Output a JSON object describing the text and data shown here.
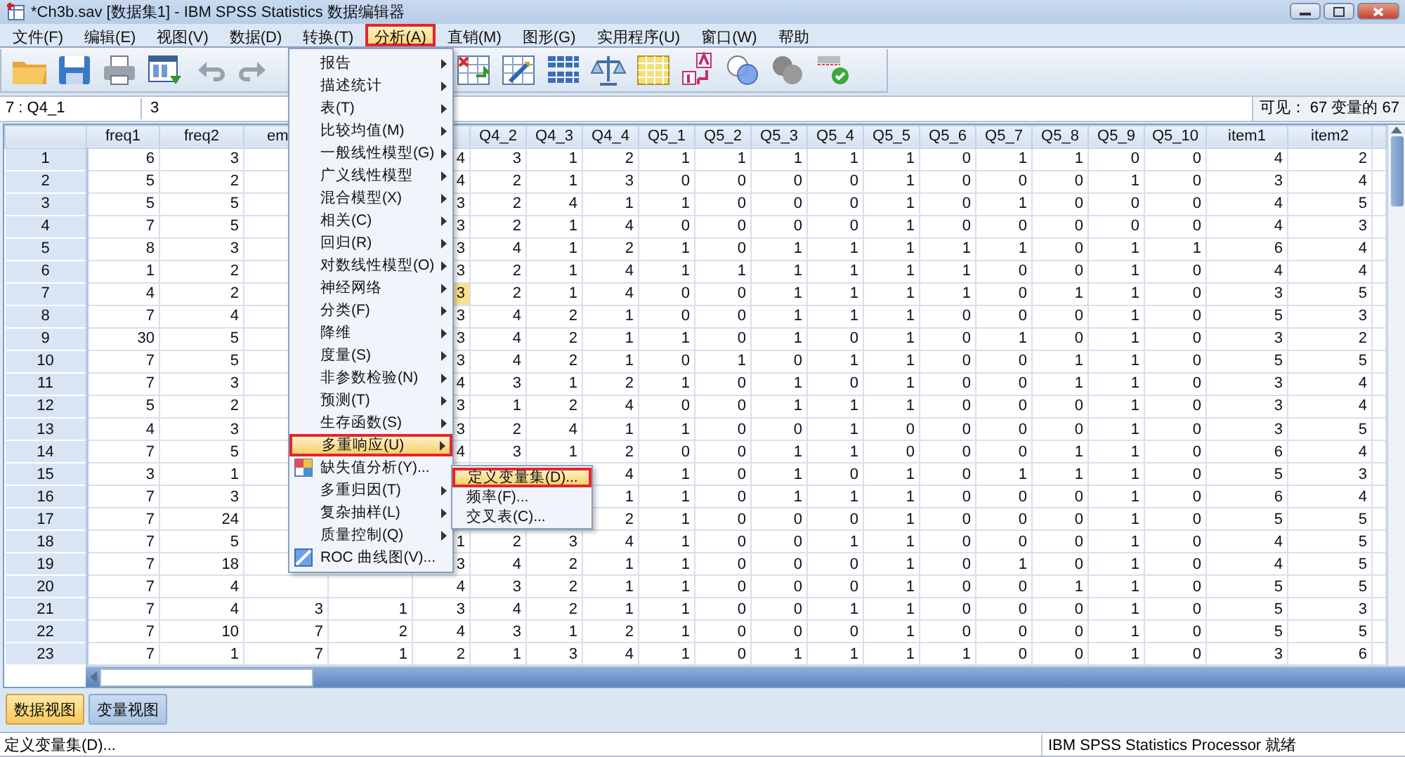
{
  "window": {
    "title": "*Ch3b.sav [数据集1] - IBM SPSS Statistics 数据编辑器"
  },
  "menu_bar": [
    {
      "label": "文件(F)",
      "selected": false,
      "marked": false
    },
    {
      "label": "编辑(E)",
      "selected": false,
      "marked": false
    },
    {
      "label": "视图(V)",
      "selected": false,
      "marked": false
    },
    {
      "label": "数据(D)",
      "selected": false,
      "marked": false
    },
    {
      "label": "转换(T)",
      "selected": false,
      "marked": false
    },
    {
      "label": "分析(A)",
      "selected": true,
      "marked": true
    },
    {
      "label": "直销(M)",
      "selected": false,
      "marked": false
    },
    {
      "label": "图形(G)",
      "selected": false,
      "marked": false
    },
    {
      "label": "实用程序(U)",
      "selected": false,
      "marked": false
    },
    {
      "label": "窗口(W)",
      "selected": false,
      "marked": false
    },
    {
      "label": "帮助",
      "selected": false,
      "marked": false
    }
  ],
  "cell_editor": {
    "cell": "7 : Q4_1",
    "value": "3",
    "visible_count": "可见： 67 变量的 67"
  },
  "table": {
    "columns": [
      "freq1",
      "freq2",
      "em",
      null,
      null,
      "Q4_2",
      "Q4_3",
      "Q4_4",
      "Q5_1",
      "Q5_2",
      "Q5_3",
      "Q5_4",
      "Q5_5",
      "Q5_6",
      "Q5_7",
      "Q5_8",
      "Q5_9",
      "Q5_10",
      "item1",
      "item2"
    ],
    "rows": [
      {
        "label": "1",
        "cells": [
          "6",
          "3",
          null,
          null,
          "4",
          "3",
          "1",
          "2",
          "1",
          "1",
          "1",
          "1",
          "1",
          "0",
          "1",
          "1",
          "0",
          "0",
          "4",
          "2"
        ]
      },
      {
        "label": "2",
        "cells": [
          "5",
          "2",
          null,
          null,
          "4",
          "2",
          "1",
          "3",
          "0",
          "0",
          "0",
          "0",
          "1",
          "0",
          "0",
          "0",
          "1",
          "0",
          "3",
          "4"
        ]
      },
      {
        "label": "3",
        "cells": [
          "5",
          "5",
          null,
          null,
          "3",
          "2",
          "4",
          "1",
          "1",
          "0",
          "0",
          "0",
          "1",
          "0",
          "1",
          "0",
          "0",
          "0",
          "4",
          "5"
        ]
      },
      {
        "label": "4",
        "cells": [
          "7",
          "5",
          null,
          null,
          "3",
          "2",
          "1",
          "4",
          "0",
          "0",
          "0",
          "0",
          "1",
          "0",
          "0",
          "0",
          "0",
          "0",
          "4",
          "3"
        ]
      },
      {
        "label": "5",
        "cells": [
          "8",
          "3",
          null,
          null,
          "3",
          "4",
          "1",
          "2",
          "1",
          "0",
          "1",
          "1",
          "1",
          "1",
          "1",
          "0",
          "1",
          "1",
          "6",
          "4"
        ]
      },
      {
        "label": "6",
        "cells": [
          "1",
          "2",
          null,
          null,
          "3",
          "2",
          "1",
          "4",
          "1",
          "1",
          "1",
          "1",
          "1",
          "1",
          "0",
          "0",
          "1",
          "0",
          "4",
          "4"
        ]
      },
      {
        "label": "7",
        "cells": [
          "4",
          "2",
          null,
          null,
          {
            "value": "3",
            "selected": true
          },
          "2",
          "1",
          "4",
          "0",
          "0",
          "1",
          "1",
          "1",
          "1",
          "0",
          "1",
          "1",
          "0",
          "3",
          "5"
        ]
      },
      {
        "label": "8",
        "cells": [
          "7",
          "4",
          null,
          null,
          "3",
          "4",
          "2",
          "1",
          "0",
          "0",
          "1",
          "1",
          "1",
          "0",
          "0",
          "0",
          "1",
          "0",
          "5",
          "3"
        ]
      },
      {
        "label": "9",
        "cells": [
          "30",
          "5",
          null,
          null,
          "3",
          "4",
          "2",
          "1",
          "1",
          "0",
          "1",
          "0",
          "1",
          "0",
          "1",
          "0",
          "1",
          "0",
          "3",
          "2"
        ]
      },
      {
        "label": "10",
        "cells": [
          "7",
          "5",
          null,
          null,
          "3",
          "4",
          "2",
          "1",
          "0",
          "1",
          "0",
          "1",
          "1",
          "0",
          "0",
          "1",
          "1",
          "0",
          "5",
          "5"
        ]
      },
      {
        "label": "11",
        "cells": [
          "7",
          "3",
          null,
          null,
          "4",
          "3",
          "1",
          "2",
          "1",
          "0",
          "1",
          "0",
          "1",
          "0",
          "0",
          "1",
          "1",
          "0",
          "3",
          "4"
        ]
      },
      {
        "label": "12",
        "cells": [
          "5",
          "2",
          null,
          null,
          "3",
          "1",
          "2",
          "4",
          "0",
          "0",
          "1",
          "1",
          "1",
          "0",
          "0",
          "0",
          "1",
          "0",
          "3",
          "4"
        ]
      },
      {
        "label": "13",
        "cells": [
          "4",
          "3",
          null,
          null,
          "3",
          "2",
          "4",
          "1",
          "1",
          "0",
          "0",
          "1",
          "0",
          "0",
          "0",
          "0",
          "1",
          "0",
          "3",
          "5"
        ]
      },
      {
        "label": "14",
        "cells": [
          "7",
          "5",
          null,
          null,
          "4",
          "3",
          "1",
          "2",
          "0",
          "0",
          "1",
          "1",
          "0",
          "0",
          "0",
          "1",
          "1",
          "0",
          "6",
          "4"
        ]
      },
      {
        "label": "15",
        "cells": [
          "3",
          "1",
          null,
          null,
          null,
          null,
          null,
          "4",
          "1",
          "0",
          "1",
          "0",
          "1",
          "0",
          "1",
          "1",
          "1",
          "0",
          "5",
          "3"
        ]
      },
      {
        "label": "16",
        "cells": [
          "7",
          "3",
          null,
          null,
          null,
          null,
          null,
          "1",
          "1",
          "0",
          "1",
          "1",
          "1",
          "0",
          "0",
          "0",
          "1",
          "0",
          "6",
          "4"
        ]
      },
      {
        "label": "17",
        "cells": [
          "7",
          "24",
          null,
          null,
          null,
          null,
          null,
          "2",
          "1",
          "0",
          "0",
          "0",
          "1",
          "0",
          "0",
          "0",
          "1",
          "0",
          "5",
          "5"
        ]
      },
      {
        "label": "18",
        "cells": [
          "7",
          "5",
          null,
          null,
          "1",
          "2",
          "3",
          "4",
          "1",
          "0",
          "0",
          "1",
          "1",
          "0",
          "0",
          "0",
          "1",
          "0",
          "4",
          "5"
        ]
      },
      {
        "label": "19",
        "cells": [
          "7",
          "18",
          null,
          null,
          "3",
          "4",
          "2",
          "1",
          "1",
          "0",
          "0",
          "0",
          "1",
          "0",
          "1",
          "0",
          "1",
          "0",
          "4",
          "5"
        ]
      },
      {
        "label": "20",
        "cells": [
          "7",
          "4",
          null,
          null,
          "4",
          "3",
          "2",
          "1",
          "1",
          "0",
          "0",
          "0",
          "1",
          "0",
          "0",
          "1",
          "1",
          "0",
          "5",
          "5"
        ]
      },
      {
        "label": "21",
        "cells": [
          "7",
          "4",
          "3",
          "1",
          "3",
          "4",
          "2",
          "1",
          "1",
          "0",
          "0",
          "1",
          "1",
          "0",
          "0",
          "0",
          "1",
          "0",
          "5",
          "3"
        ]
      },
      {
        "label": "22",
        "cells": [
          "7",
          "10",
          "7",
          "2",
          "4",
          "3",
          "1",
          "2",
          "1",
          "0",
          "0",
          "0",
          "1",
          "0",
          "0",
          "0",
          "1",
          "0",
          "5",
          "5"
        ]
      },
      {
        "label": "23",
        "cells": [
          "7",
          "1",
          "7",
          "1",
          "2",
          "1",
          "3",
          "4",
          "1",
          "0",
          "1",
          "1",
          "1",
          "1",
          "0",
          "0",
          "1",
          "0",
          "3",
          "6"
        ]
      }
    ]
  },
  "view_tabs": [
    {
      "label": "数据视图",
      "selected": true
    },
    {
      "label": "变量视图",
      "selected": false
    }
  ],
  "status_bar": {
    "message": "定义变量集(D)...",
    "processor": "IBM SPSS Statistics Processor 就绪"
  },
  "analysis_menu": {
    "items": [
      {
        "label": "报告",
        "kind": "submenu",
        "selected": false,
        "marked": false
      },
      {
        "label": "描述统计",
        "kind": "submenu",
        "selected": false,
        "marked": false
      },
      {
        "label": "表(T)",
        "kind": "submenu",
        "selected": false,
        "marked": false
      },
      {
        "label": "比较均值(M)",
        "kind": "submenu",
        "selected": false,
        "marked": false
      },
      {
        "label": "一般线性模型(G)",
        "kind": "submenu",
        "selected": false,
        "marked": false
      },
      {
        "label": "广义线性模型",
        "kind": "submenu",
        "selected": false,
        "marked": false
      },
      {
        "label": "混合模型(X)",
        "kind": "submenu",
        "selected": false,
        "marked": false
      },
      {
        "label": "相关(C)",
        "kind": "submenu",
        "selected": false,
        "marked": false
      },
      {
        "label": "回归(R)",
        "kind": "submenu",
        "selected": false,
        "marked": false
      },
      {
        "label": "对数线性模型(O)",
        "kind": "submenu",
        "selected": false,
        "marked": false
      },
      {
        "label": "神经网络",
        "kind": "submenu",
        "selected": false,
        "marked": false
      },
      {
        "label": "分类(F)",
        "kind": "submenu",
        "selected": false,
        "marked": false
      },
      {
        "label": "降维",
        "kind": "submenu",
        "selected": false,
        "marked": false
      },
      {
        "label": "度量(S)",
        "kind": "submenu",
        "selected": false,
        "marked": false
      },
      {
        "label": "非参数检验(N)",
        "kind": "submenu",
        "selected": false,
        "marked": false
      },
      {
        "label": "预测(T)",
        "kind": "submenu",
        "selected": false,
        "marked": false
      },
      {
        "label": "生存函数(S)",
        "kind": "submenu",
        "selected": false,
        "marked": false
      },
      {
        "label": "多重响应(U)",
        "kind": "submenu",
        "selected": true,
        "marked": true
      },
      {
        "label": "缺失值分析(Y)...",
        "kind": "command",
        "selected": false,
        "marked": false
      },
      {
        "label": "多重归因(T)",
        "kind": "submenu",
        "selected": false,
        "marked": false
      },
      {
        "label": "复杂抽样(L)",
        "kind": "submenu",
        "selected": false,
        "marked": false
      },
      {
        "label": "质量控制(Q)",
        "kind": "submenu",
        "selected": false,
        "marked": false
      },
      {
        "label": "ROC 曲线图(V)...",
        "kind": "command",
        "selected": false,
        "marked": false
      }
    ]
  },
  "multiple_response_menu": {
    "items": [
      {
        "label": "定义变量集(D)...",
        "kind": "command",
        "selected": true,
        "marked": true
      },
      {
        "label": "频率(F)...",
        "kind": "command",
        "selected": false,
        "marked": false
      },
      {
        "label": "交叉表(C)...",
        "kind": "command",
        "selected": false,
        "marked": false
      }
    ]
  }
}
